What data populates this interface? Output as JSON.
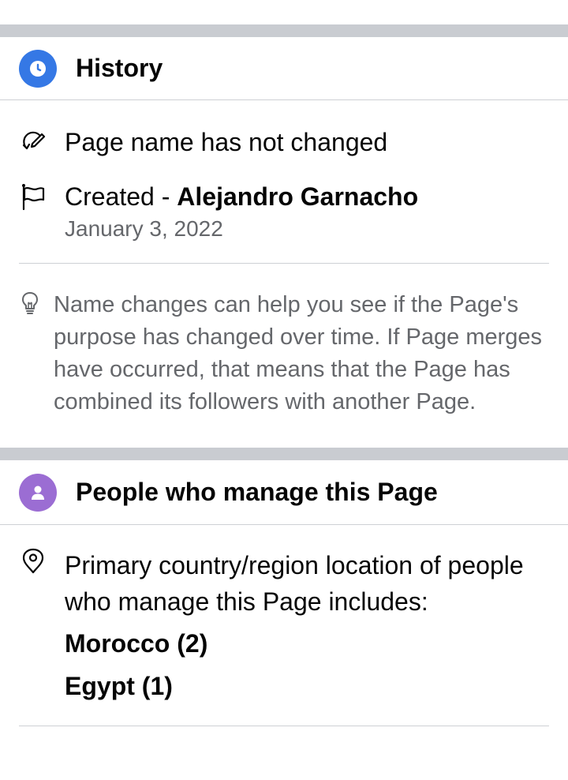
{
  "history": {
    "title": "History",
    "icon": "clock-icon",
    "accent": "#3578e5",
    "page_name_status": "Page name has not changed",
    "created_prefix": "Created - ",
    "created_by": "Alejandro Garnacho",
    "created_date": "January 3, 2022",
    "info_text": "Name changes can help you see if the Page's purpose has changed over time. If Page merges have occurred, that means that the Page has combined its followers with another Page."
  },
  "managers": {
    "title": "People who manage this Page",
    "icon": "person-icon",
    "accent": "#9b6dd3",
    "location_text": "Primary country/region location of people who manage this Page includes:",
    "countries": [
      {
        "label": "Morocco (2)"
      },
      {
        "label": "Egypt (1)"
      }
    ]
  }
}
